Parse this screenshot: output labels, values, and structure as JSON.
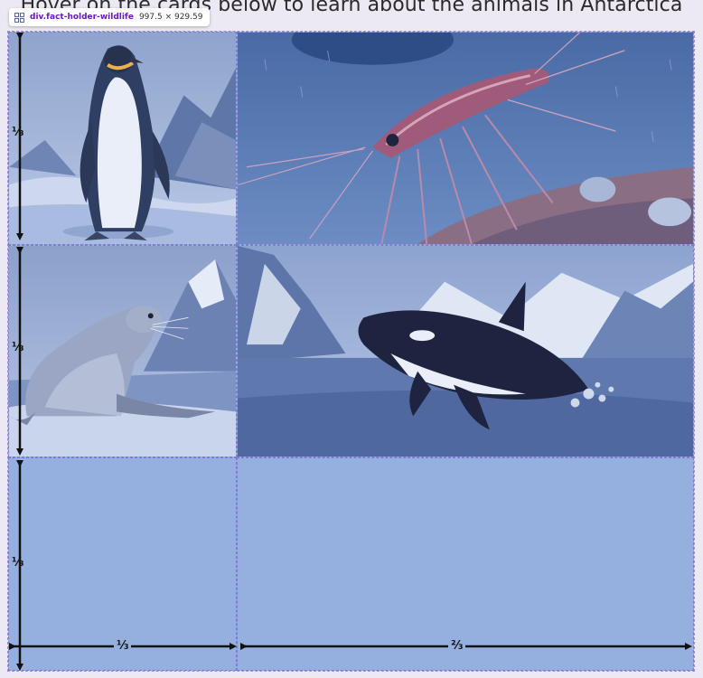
{
  "heading": "Hover on the cards below to learn about the animals in Antarctica",
  "devtools": {
    "icon": "grid-icon",
    "element": "div.fact-holder-wildlife",
    "dimensions": "997.5 × 929.59"
  },
  "cards": [
    {
      "animal": "penguin",
      "icon": "penguin-illustration"
    },
    {
      "animal": "krill",
      "icon": "krill-illustration"
    },
    {
      "animal": "seal",
      "icon": "seal-illustration"
    },
    {
      "animal": "orca",
      "icon": "orca-illustration"
    },
    {
      "animal": "",
      "icon": ""
    },
    {
      "animal": "",
      "icon": ""
    }
  ],
  "grid_overlay": {
    "row_labels": [
      "⅓",
      "⅓",
      "⅓"
    ],
    "column_labels": [
      "⅓",
      "⅔"
    ]
  },
  "colors": {
    "card_tint": "#97b2df",
    "devtools_selector": "#6a1bb0",
    "arrow": "#111111"
  }
}
